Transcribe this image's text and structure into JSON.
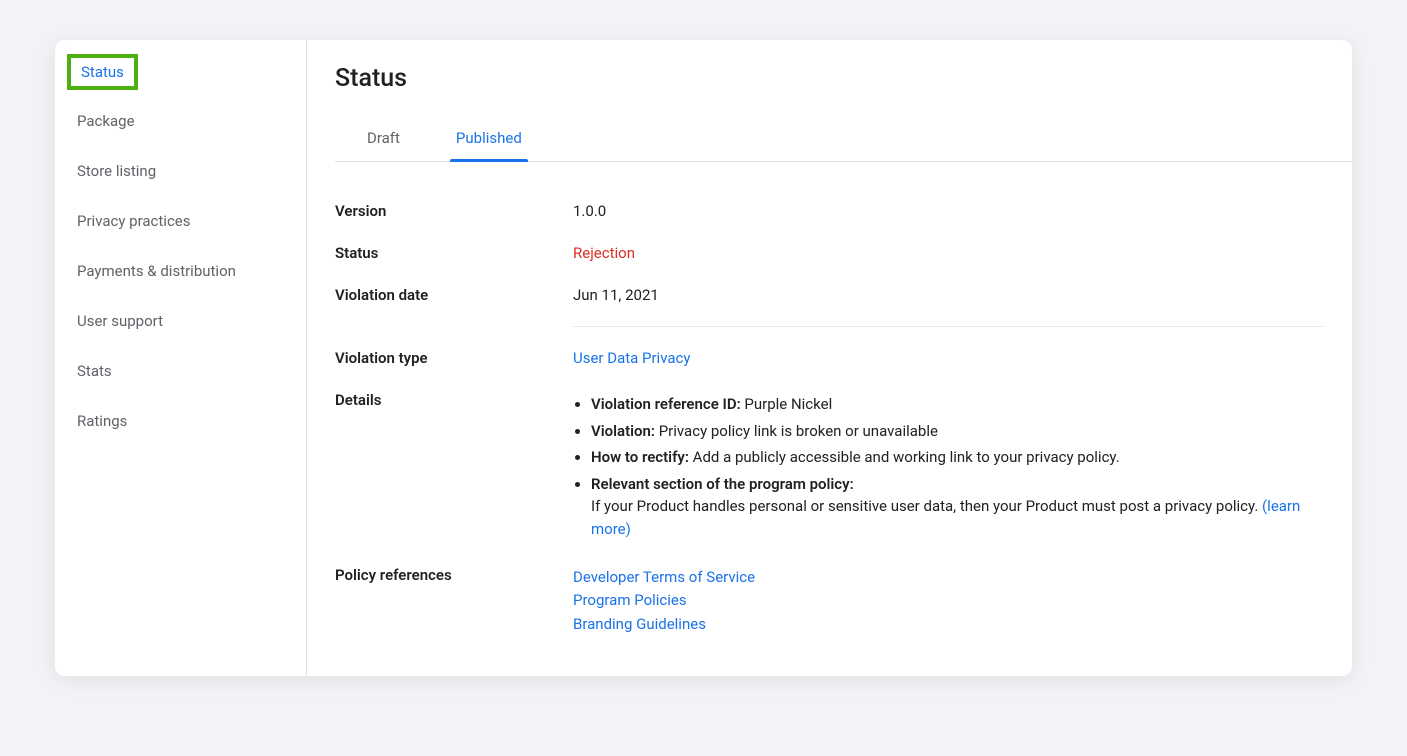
{
  "sidebar": {
    "items": [
      {
        "label": "Status",
        "active": true
      },
      {
        "label": "Package"
      },
      {
        "label": "Store listing"
      },
      {
        "label": "Privacy practices"
      },
      {
        "label": "Payments & distribution"
      },
      {
        "label": "User support"
      },
      {
        "label": "Stats"
      },
      {
        "label": "Ratings"
      }
    ]
  },
  "page": {
    "title": "Status"
  },
  "tabs": [
    {
      "label": "Draft",
      "active": false
    },
    {
      "label": "Published",
      "active": true
    }
  ],
  "fields": {
    "version_label": "Version",
    "version_value": "1.0.0",
    "status_label": "Status",
    "status_value": "Rejection",
    "violation_date_label": "Violation date",
    "violation_date_value": "Jun 11, 2021",
    "violation_type_label": "Violation type",
    "violation_type_value": "User Data Privacy",
    "details_label": "Details",
    "policy_refs_label": "Policy references"
  },
  "details": {
    "ref_id_label": "Violation reference ID:",
    "ref_id_value": " Purple Nickel",
    "violation_label": "Violation:",
    "violation_value": " Privacy policy link is broken or unavailable",
    "rectify_label": "How to rectify:",
    "rectify_value": " Add a publicly accessible and working link to your privacy policy.",
    "relevant_label": "Relevant section of the program policy:",
    "relevant_body": "If your Product handles personal or sensitive user data, then your Product must post a privacy policy.",
    "learn_more": "(learn more)"
  },
  "policy_references": [
    "Developer Terms of Service",
    "Program Policies",
    "Branding Guidelines"
  ]
}
